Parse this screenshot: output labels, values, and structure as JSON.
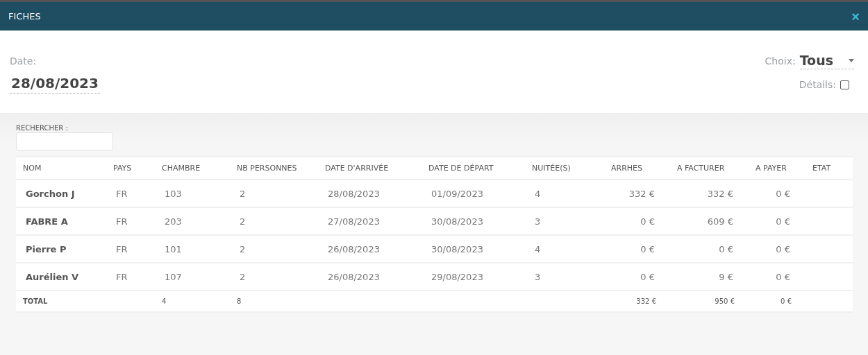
{
  "window": {
    "title": "FICHES",
    "close": "×"
  },
  "date": {
    "label": "Date:",
    "value": "28/08/2023"
  },
  "choice": {
    "label": "Choix:",
    "value": "Tous"
  },
  "details": {
    "label": "Détails:",
    "checked": false
  },
  "search": {
    "label": "RECHERCHER :"
  },
  "table": {
    "columns": [
      "NOM",
      "PAYS",
      "CHAMBRE",
      "NB PERSONNES",
      "DATE D'ARRIVÉE",
      "DATE DE DÉPART",
      "NUITÉE(S)",
      "ARRHES",
      "A FACTURER",
      "A PAYER",
      "ETAT"
    ],
    "rows": [
      {
        "nom": "Gorchon J",
        "pays": "FR",
        "chambre": "103",
        "personnes": "2",
        "arrivee": "28/08/2023",
        "depart": "01/09/2023",
        "nuitees": "4",
        "arrhes": "332 €",
        "a_facturer": "332 €",
        "a_payer": "0 €"
      },
      {
        "nom": "FABRE A",
        "pays": "FR",
        "chambre": "203",
        "personnes": "2",
        "arrivee": "27/08/2023",
        "depart": "30/08/2023",
        "nuitees": "3",
        "arrhes": "0 €",
        "a_facturer": "609 €",
        "a_payer": "0 €"
      },
      {
        "nom": "Pierre P",
        "pays": "FR",
        "chambre": "101",
        "personnes": "2",
        "arrivee": "26/08/2023",
        "depart": "30/08/2023",
        "nuitees": "4",
        "arrhes": "0 €",
        "a_facturer": "0 €",
        "a_payer": "0 €"
      },
      {
        "nom": "Aurélien V",
        "pays": "FR",
        "chambre": "107",
        "personnes": "2",
        "arrivee": "26/08/2023",
        "depart": "29/08/2023",
        "nuitees": "3",
        "arrhes": "0 €",
        "a_facturer": "9 €",
        "a_payer": "0 €"
      }
    ],
    "total": {
      "label": "TOTAL",
      "chambre": "4",
      "personnes": "8",
      "arrhes": "332 €",
      "a_facturer": "950 €",
      "a_payer": "0 €"
    }
  }
}
